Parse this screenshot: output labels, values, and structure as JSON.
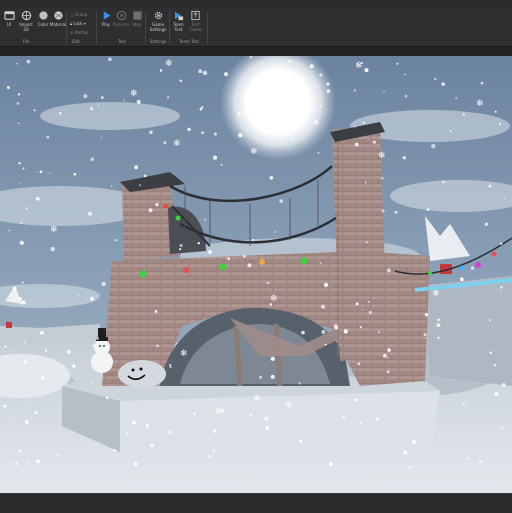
{
  "ribbon": {
    "tools": [
      {
        "key": "ui",
        "label": "UI"
      },
      {
        "key": "import3d",
        "label": "Import 3D"
      },
      {
        "key": "color",
        "label": "Color"
      },
      {
        "key": "material",
        "label": "Material"
      },
      {
        "key": "group",
        "label": "Group"
      },
      {
        "key": "lock",
        "label": "Lock"
      },
      {
        "key": "anchor",
        "label": "Anchor"
      },
      {
        "key": "play",
        "label": "Play"
      },
      {
        "key": "resume",
        "label": "Resume"
      },
      {
        "key": "stop",
        "label": "Stop"
      },
      {
        "key": "game_settings",
        "label": "Game Settings"
      },
      {
        "key": "team_test",
        "label": "Team Test"
      },
      {
        "key": "exit_game",
        "label": "Exit Game"
      }
    ],
    "groups": {
      "file": "File",
      "edit": "Edit",
      "test": "Test",
      "settings": "Settings",
      "team_test": "Team Test"
    }
  },
  "colors": {
    "ribbon_bg": "#2e2f31",
    "accent_blue": "#3b8fe0",
    "sky": "#7f96ad",
    "snow": "#e8ecf0",
    "brick": "#a88d88"
  },
  "icons": [
    "ui-icon",
    "import-3d-icon",
    "color-icon",
    "material-icon",
    "group-icon",
    "lock-icon",
    "anchor-icon",
    "play-icon",
    "resume-icon",
    "stop-icon",
    "gear-icon",
    "team-test-icon",
    "exit-game-icon"
  ]
}
